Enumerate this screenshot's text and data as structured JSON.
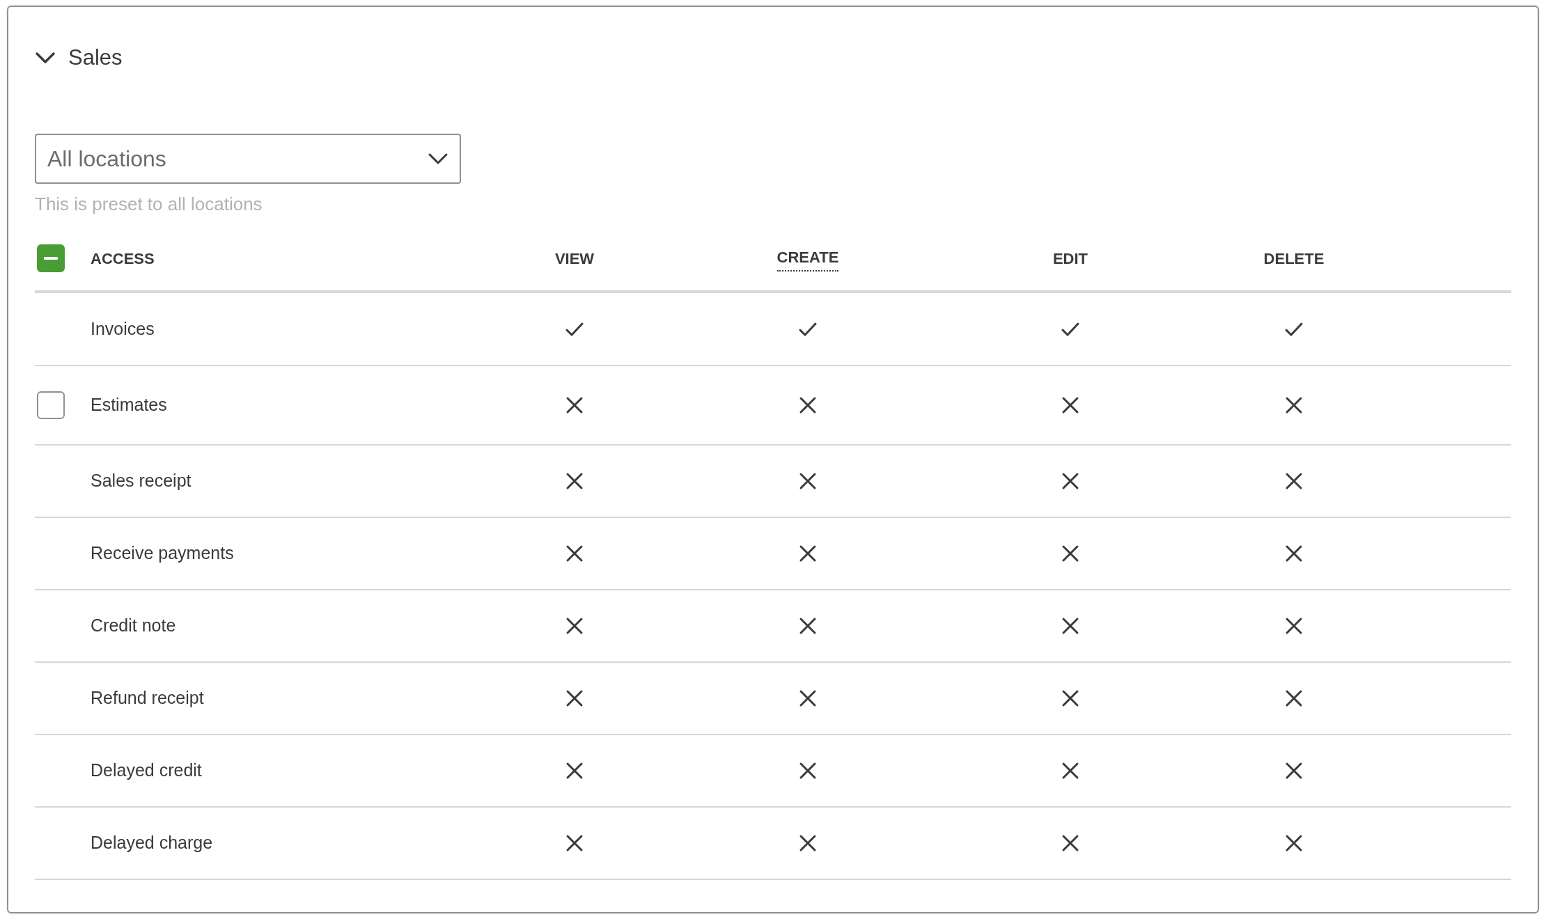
{
  "section": {
    "title": "Sales",
    "expanded": true
  },
  "location_select": {
    "value": "All locations",
    "hint": "This is preset to all locations"
  },
  "table": {
    "select_all": {
      "indeterminate": true
    },
    "columns": [
      {
        "label": "ACCESS",
        "dotted_underline": false
      },
      {
        "label": "VIEW",
        "dotted_underline": false
      },
      {
        "label": "CREATE",
        "dotted_underline": true
      },
      {
        "label": "EDIT",
        "dotted_underline": false
      },
      {
        "label": "DELETE",
        "dotted_underline": false
      }
    ],
    "rows": [
      {
        "name": "Invoices",
        "view": true,
        "create": true,
        "edit": true,
        "delete": true
      },
      {
        "name": "Estimates",
        "checked": false,
        "view": false,
        "create": false,
        "edit": false,
        "delete": false
      },
      {
        "name": "Sales receipt",
        "view": false,
        "create": false,
        "edit": false,
        "delete": false
      },
      {
        "name": "Receive payments",
        "view": false,
        "create": false,
        "edit": false,
        "delete": false
      },
      {
        "name": "Credit note",
        "view": false,
        "create": false,
        "edit": false,
        "delete": false
      },
      {
        "name": "Refund receipt",
        "view": false,
        "create": false,
        "edit": false,
        "delete": false
      },
      {
        "name": "Delayed credit",
        "view": false,
        "create": false,
        "edit": false,
        "delete": false
      },
      {
        "name": "Delayed charge",
        "view": false,
        "create": false,
        "edit": false,
        "delete": false
      }
    ]
  }
}
